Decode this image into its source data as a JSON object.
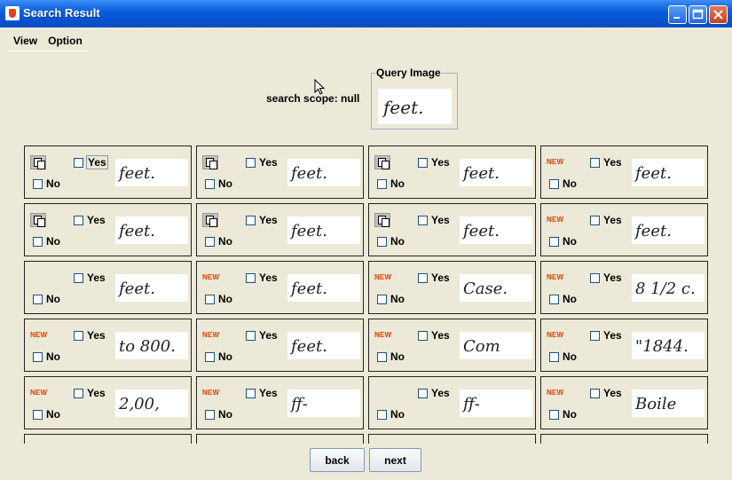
{
  "window": {
    "title": "Search Result"
  },
  "menubar": {
    "items": [
      "View",
      "Option"
    ]
  },
  "search": {
    "scope_label": "search scope: null"
  },
  "query": {
    "label": "Query Image",
    "image_text": "feet."
  },
  "results": [
    {
      "badge": "copy",
      "yes": "Yes",
      "no": "No",
      "word": "feet."
    },
    {
      "badge": "copy",
      "yes": "Yes",
      "no": "No",
      "word": "feet."
    },
    {
      "badge": "copy",
      "yes": "Yes",
      "no": "No",
      "word": "feet."
    },
    {
      "badge": "NEW",
      "yes": "Yes",
      "no": "No",
      "word": "feet."
    },
    {
      "badge": "copy",
      "yes": "Yes",
      "no": "No",
      "word": "feet."
    },
    {
      "badge": "copy",
      "yes": "Yes",
      "no": "No",
      "word": "feet."
    },
    {
      "badge": "copy",
      "yes": "Yes",
      "no": "No",
      "word": "feet."
    },
    {
      "badge": "NEW",
      "yes": "Yes",
      "no": "No",
      "word": "feet."
    },
    {
      "badge": "",
      "yes": "Yes",
      "no": "No",
      "word": "feet."
    },
    {
      "badge": "NEW",
      "yes": "Yes",
      "no": "No",
      "word": "feet."
    },
    {
      "badge": "NEW",
      "yes": "Yes",
      "no": "No",
      "word": "Case."
    },
    {
      "badge": "NEW",
      "yes": "Yes",
      "no": "No",
      "word": "8 1/2 c."
    },
    {
      "badge": "NEW",
      "yes": "Yes",
      "no": "No",
      "word": "to 800."
    },
    {
      "badge": "NEW",
      "yes": "Yes",
      "no": "No",
      "word": "feet."
    },
    {
      "badge": "NEW",
      "yes": "Yes",
      "no": "No",
      "word": "Com"
    },
    {
      "badge": "NEW",
      "yes": "Yes",
      "no": "No",
      "word": "\"1844."
    },
    {
      "badge": "NEW",
      "yes": "Yes",
      "no": "No",
      "word": "2,00,"
    },
    {
      "badge": "NEW",
      "yes": "Yes",
      "no": "No",
      "word": "ff-"
    },
    {
      "badge": "",
      "yes": "Yes",
      "no": "No",
      "word": "ff-"
    },
    {
      "badge": "NEW",
      "yes": "Yes",
      "no": "No",
      "word": "Boile"
    }
  ],
  "buttons": {
    "back": "back",
    "next": "next"
  }
}
